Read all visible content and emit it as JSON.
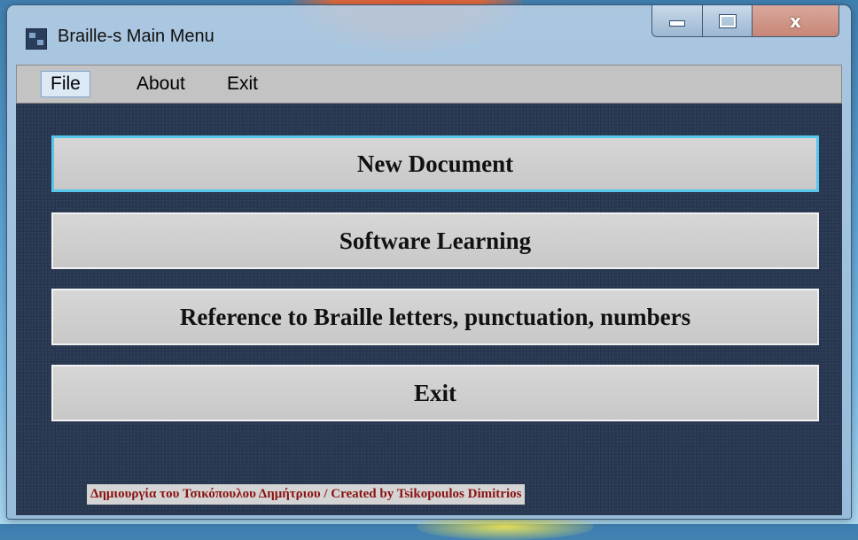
{
  "window": {
    "title": "Braille-s Main Menu",
    "close_glyph": "x"
  },
  "menubar": {
    "items": [
      {
        "label": "File"
      },
      {
        "label": "About"
      },
      {
        "label": "Exit"
      }
    ]
  },
  "main": {
    "buttons": [
      {
        "label": "New Document"
      },
      {
        "label": "Software Learning"
      },
      {
        "label": "Reference to Braille letters, punctuation, numbers"
      },
      {
        "label": "Exit"
      }
    ],
    "credit": "Δημιουργία του Τσικόπουλου Δημήτριου / Created by Tsikopoulos Dimitrios"
  },
  "colors": {
    "client_background": "#2a3a55",
    "button_face": "#d0d0d0",
    "focus_border": "#57c6ec",
    "credit_text": "#8b1212"
  }
}
